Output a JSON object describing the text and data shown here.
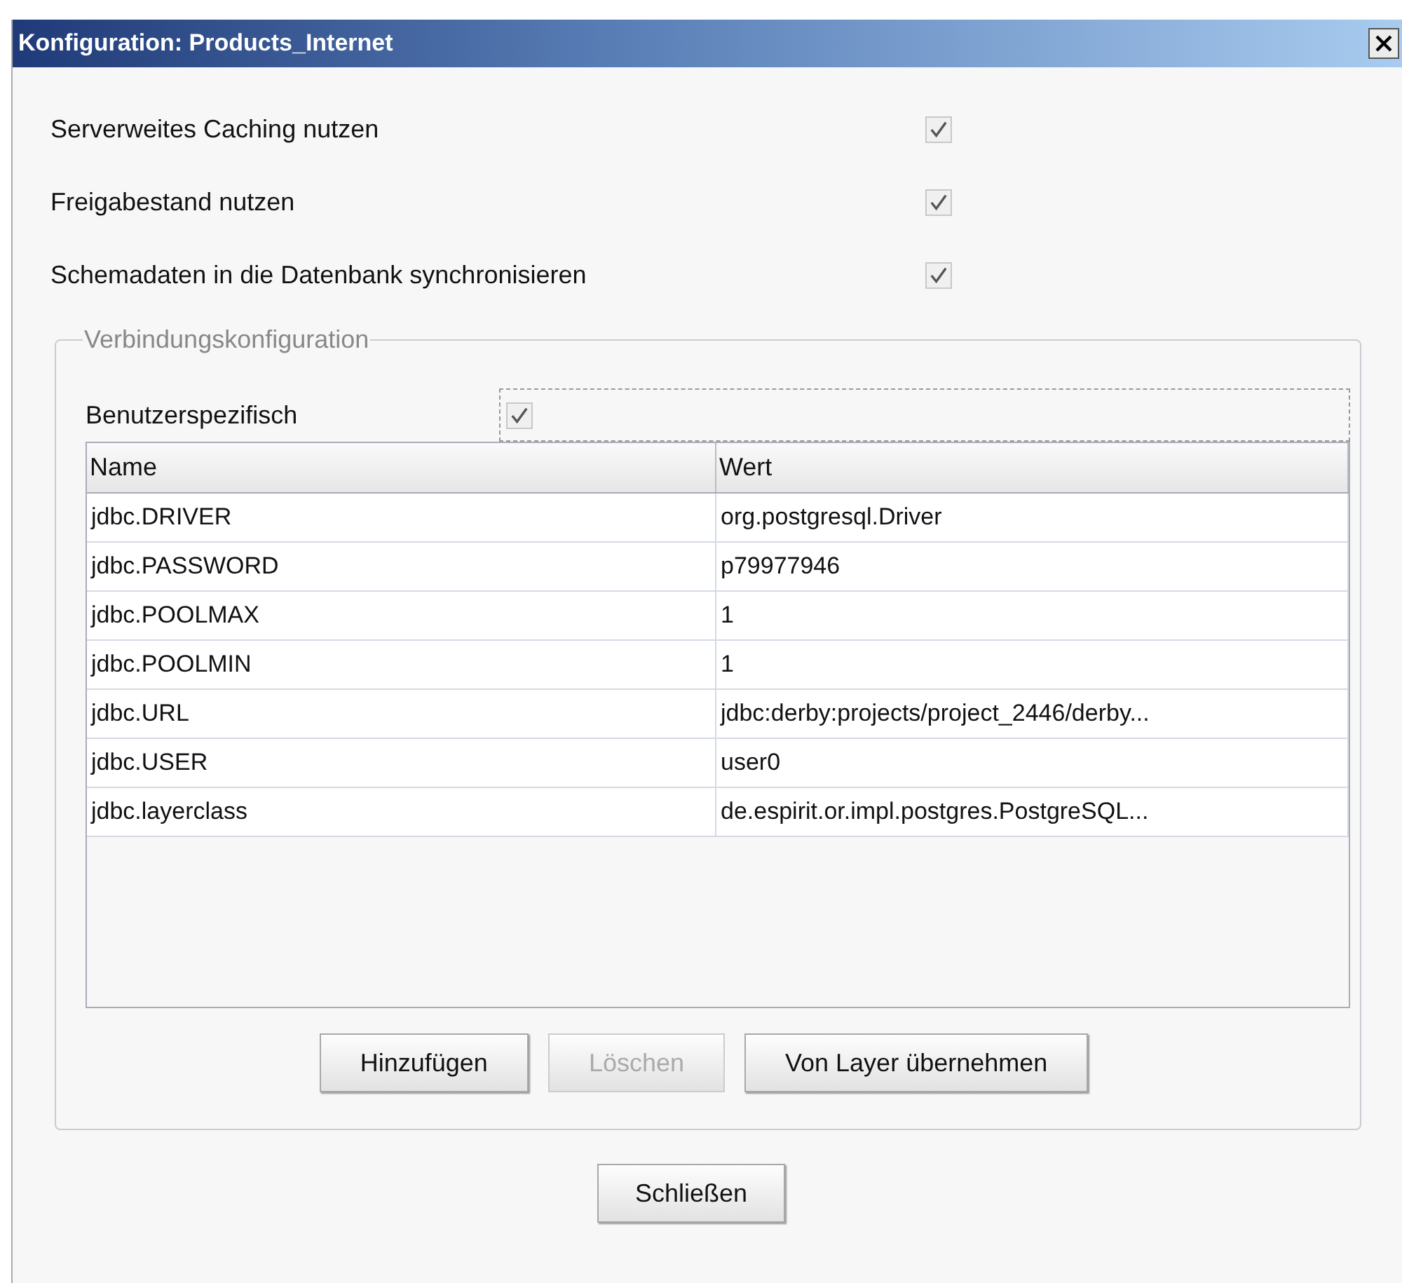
{
  "window": {
    "title": "Konfiguration: Products_Internet"
  },
  "options": [
    {
      "label": "Serverweites Caching nutzen",
      "checked": true
    },
    {
      "label": "Freigabestand nutzen",
      "checked": true
    },
    {
      "label": "Schemadaten in die Datenbank synchronisieren",
      "checked": true
    }
  ],
  "connection": {
    "legend": "Verbindungskonfiguration",
    "user_specific": {
      "label": "Benutzerspezifisch",
      "checked": true
    },
    "table": {
      "columns": [
        "Name",
        "Wert"
      ],
      "rows": [
        [
          "jdbc.DRIVER",
          "org.postgresql.Driver"
        ],
        [
          "jdbc.PASSWORD",
          "p79977946"
        ],
        [
          "jdbc.POOLMAX",
          "1"
        ],
        [
          "jdbc.POOLMIN",
          "1"
        ],
        [
          "jdbc.URL",
          "jdbc:derby:projects/project_2446/derby..."
        ],
        [
          "jdbc.USER",
          "user0"
        ],
        [
          "jdbc.layerclass",
          "de.espirit.or.impl.postgres.PostgreSQL..."
        ]
      ]
    },
    "buttons": [
      {
        "label": "Hinzufügen",
        "disabled": false
      },
      {
        "label": "Löschen",
        "disabled": true
      },
      {
        "label": "Von Layer übernehmen",
        "disabled": false
      }
    ]
  },
  "footer_buttons": [
    {
      "label": "Schließen",
      "disabled": false
    }
  ]
}
